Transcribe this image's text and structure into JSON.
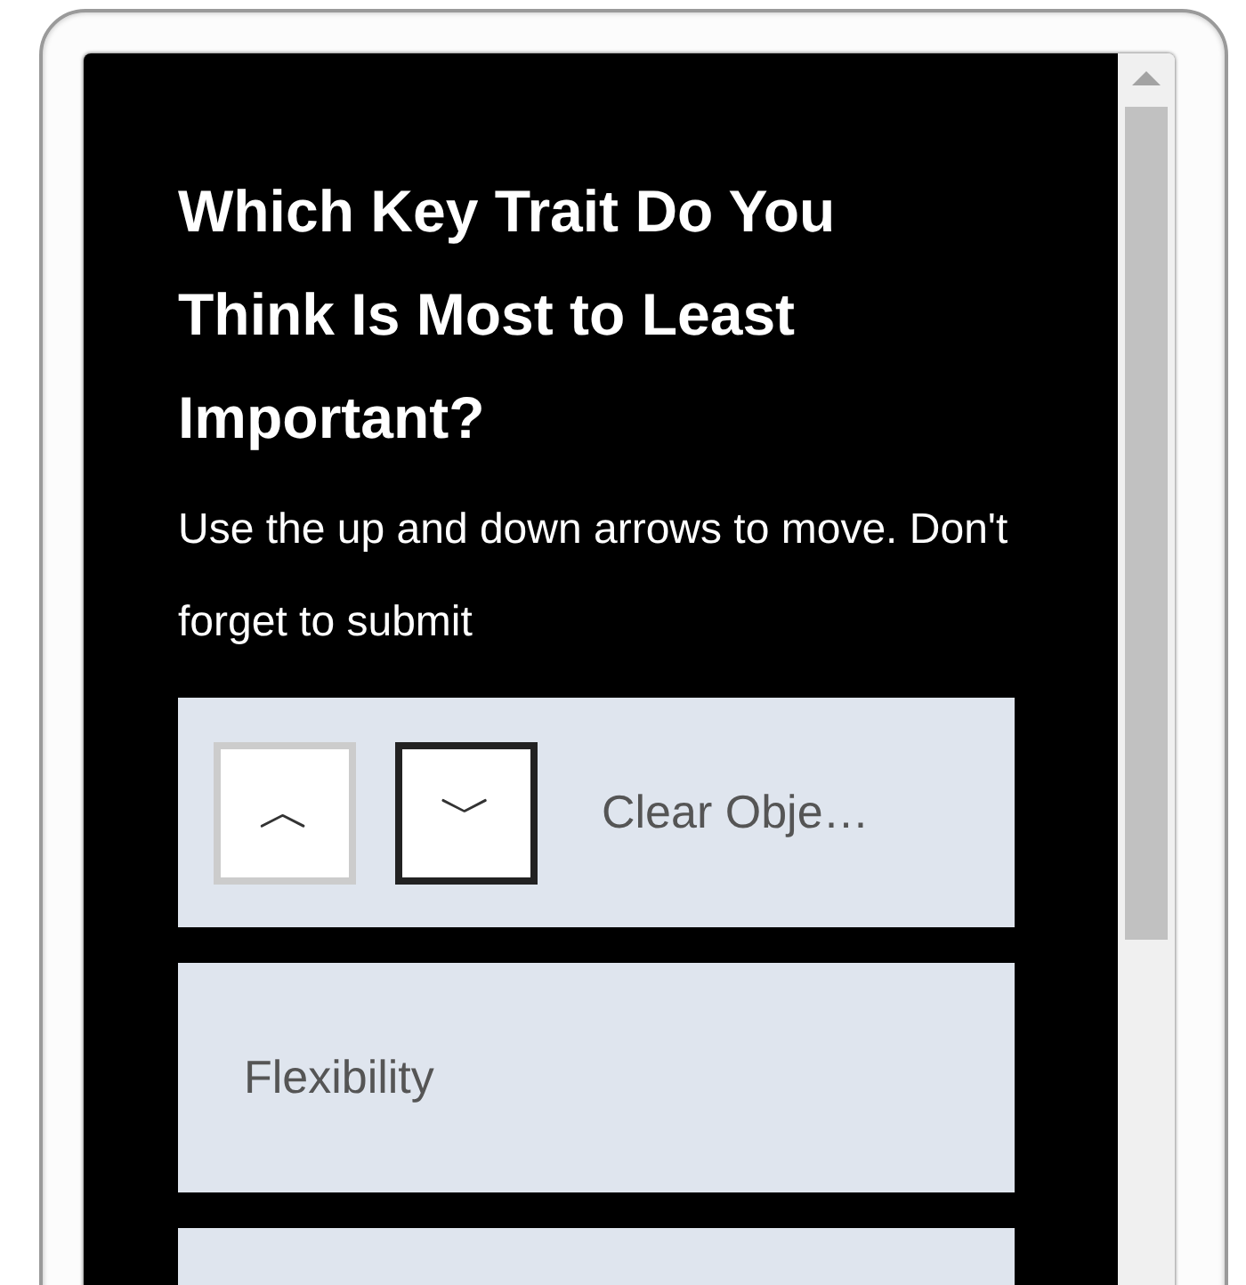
{
  "title": "Which Key Trait Do You Think Is Most to Least Important?",
  "instructions": "Use the up and down arrows to move. Don't forget to submit",
  "items": [
    {
      "kind": "active",
      "label": "Clear Obje…",
      "up": {
        "symbol": "︿",
        "disabled": true
      },
      "down": {
        "symbol": "﹀",
        "disabled": false
      }
    },
    {
      "kind": "plain",
      "label": "Flexibility"
    },
    {
      "kind": "plain"
    }
  ]
}
